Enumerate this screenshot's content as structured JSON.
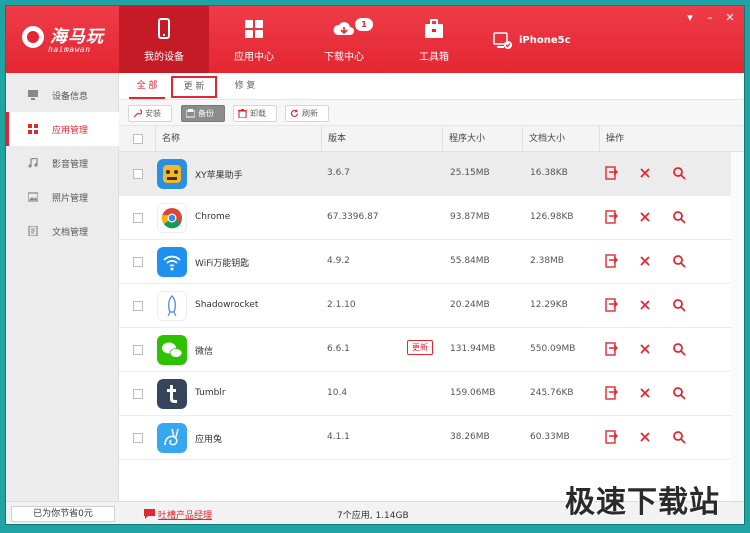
{
  "app": {
    "logo_text": "海马玩",
    "logo_subtext": "haimawan",
    "brand_color": "#e42632",
    "device_name": "iPhone5c"
  },
  "nav": [
    {
      "label": "我的设备",
      "icon": "phone-icon",
      "active": true
    },
    {
      "label": "应用中心",
      "icon": "apps-grid-icon",
      "active": false
    },
    {
      "label": "下载中心",
      "icon": "cloud-download-icon",
      "active": false,
      "badge": "1"
    },
    {
      "label": "工具箱",
      "icon": "toolbox-icon",
      "active": false
    }
  ],
  "window_controls": [
    "▾",
    "–",
    "✕"
  ],
  "sidebar": [
    {
      "label": "设备信息",
      "icon": "monitor-icon"
    },
    {
      "label": "应用管理",
      "icon": "grid-icon",
      "active": true
    },
    {
      "label": "影音管理",
      "icon": "music-icon"
    },
    {
      "label": "照片管理",
      "icon": "image-icon"
    },
    {
      "label": "文档管理",
      "icon": "document-icon"
    }
  ],
  "tabs": [
    {
      "label": "全 部",
      "active": true
    },
    {
      "label": "更 新",
      "highlighted": true
    },
    {
      "label": "修 复"
    }
  ],
  "toolbar": {
    "install": "安装",
    "backup": "备份",
    "uninstall": "卸载",
    "refresh": "刷新"
  },
  "table": {
    "headers": [
      "名称",
      "版本",
      "程序大小",
      "文档大小",
      "操作"
    ],
    "rows": [
      {
        "name": "XY苹果助手",
        "version": "3.6.7",
        "app_size": "25.15MB",
        "doc_size": "16.38KB",
        "icon": "xy-assistant-icon"
      },
      {
        "name": "Chrome",
        "version": "67.3396.87",
        "app_size": "93.87MB",
        "doc_size": "126.98KB",
        "icon": "chrome-icon"
      },
      {
        "name": "WiFi万能钥匙",
        "version": "4.9.2",
        "app_size": "55.84MB",
        "doc_size": "2.38MB",
        "icon": "wifi-key-icon"
      },
      {
        "name": "Shadowrocket",
        "version": "2.1.10",
        "app_size": "20.24MB",
        "doc_size": "12.29KB",
        "icon": "rocket-icon"
      },
      {
        "name": "微信",
        "version": "6.6.1",
        "app_size": "131.94MB",
        "doc_size": "550.09MB",
        "icon": "wechat-icon",
        "update_label": "更新"
      },
      {
        "name": "Tumblr",
        "version": "10.4",
        "app_size": "159.06MB",
        "doc_size": "245.76KB",
        "icon": "tumblr-icon"
      },
      {
        "name": "应用兔",
        "version": "4.1.1",
        "app_size": "38.26MB",
        "doc_size": "60.33MB",
        "icon": "rabbit-icon"
      }
    ]
  },
  "status": {
    "saved": "已为你节省0元",
    "feedback": "吐槽产品经理",
    "summary": "7个应用, 1.14GB"
  },
  "watermark": "极速下载站"
}
